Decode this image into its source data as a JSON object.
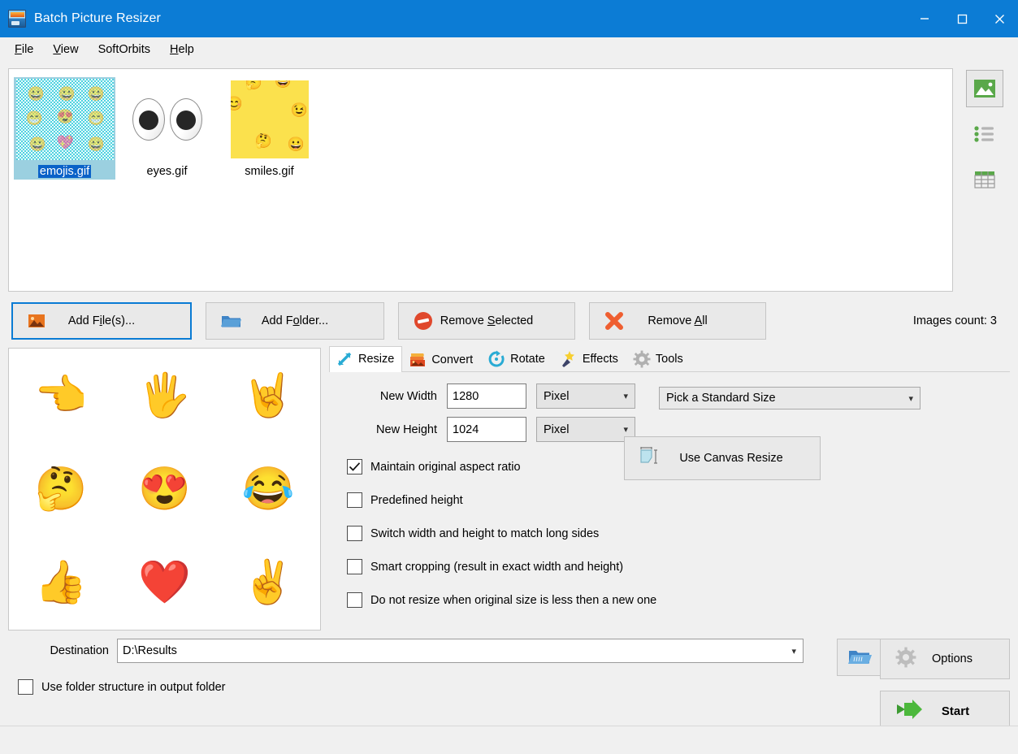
{
  "window": {
    "title": "Batch Picture Resizer",
    "app_icon": "picture-frame-icon",
    "minimize": "—",
    "maximize": "□",
    "close": "✕",
    "titlebar_color": "#0c7cd5"
  },
  "menu": [
    {
      "label": "File",
      "accel": "F"
    },
    {
      "label": "View",
      "accel": "V"
    },
    {
      "label": "SoftOrbits",
      "accel": ""
    },
    {
      "label": "Help",
      "accel": "H"
    }
  ],
  "filmstrip": {
    "files": [
      {
        "name": "emojis.gif",
        "selected": true,
        "kind": "checkered"
      },
      {
        "name": "eyes.gif",
        "selected": false,
        "kind": "eyes"
      },
      {
        "name": "smiles.gif",
        "selected": false,
        "kind": "smiles"
      }
    ]
  },
  "view_modes": [
    {
      "name": "thumbnail-view",
      "label": "Thumbnails",
      "active": true
    },
    {
      "name": "list-view",
      "label": "List",
      "active": false
    },
    {
      "name": "details-view",
      "label": "Details",
      "active": false
    }
  ],
  "actions": {
    "add_files": {
      "label": "Add File(s)...",
      "accel": "i",
      "focused": true
    },
    "add_folder": {
      "label": "Add Folder...",
      "accel": "o",
      "focused": false
    },
    "remove_selected": {
      "label": "Remove Selected",
      "accel": "S",
      "focused": false
    },
    "remove_all": {
      "label": "Remove All",
      "accel": "A",
      "focused": false
    },
    "images_count": "Images count: 3"
  },
  "tabs": [
    {
      "label": "Resize",
      "icon": "resize-arrows-icon",
      "active": true
    },
    {
      "label": "Convert",
      "icon": "convert-image-icon",
      "active": false
    },
    {
      "label": "Rotate",
      "icon": "rotate-circle-icon",
      "active": false
    },
    {
      "label": "Effects",
      "icon": "magic-wand-icon",
      "active": false
    },
    {
      "label": "Tools",
      "icon": "gear-icon",
      "active": false
    }
  ],
  "resize": {
    "new_width_label": "New Width",
    "new_width_value": "1280",
    "new_width_unit": "Pixel",
    "new_height_label": "New Height",
    "new_height_value": "1024",
    "new_height_unit": "Pixel",
    "standard_size": "Pick a Standard Size",
    "canvas_resize": "Use Canvas Resize",
    "checkboxes": [
      {
        "label": "Maintain original aspect ratio",
        "checked": true
      },
      {
        "label": "Predefined height",
        "checked": false
      },
      {
        "label": "Switch width and height to match long sides",
        "checked": false
      },
      {
        "label": "Smart cropping (result in exact width and height)",
        "checked": false
      },
      {
        "label": "Do not resize when original size is less then a new one",
        "checked": false
      }
    ]
  },
  "preview": {
    "emojis": [
      "👈",
      "🖐️",
      "🤘",
      "🤔",
      "😍",
      "😂",
      "👍",
      "❤️",
      "✌️"
    ]
  },
  "bottom": {
    "destination_label": "Destination",
    "destination_value": "D:\\Results",
    "browse_icon": "open-folder-icon",
    "folder_structure_label": "Use folder structure in output folder",
    "folder_structure_checked": false,
    "options_label": "Options",
    "start_label": "Start"
  }
}
